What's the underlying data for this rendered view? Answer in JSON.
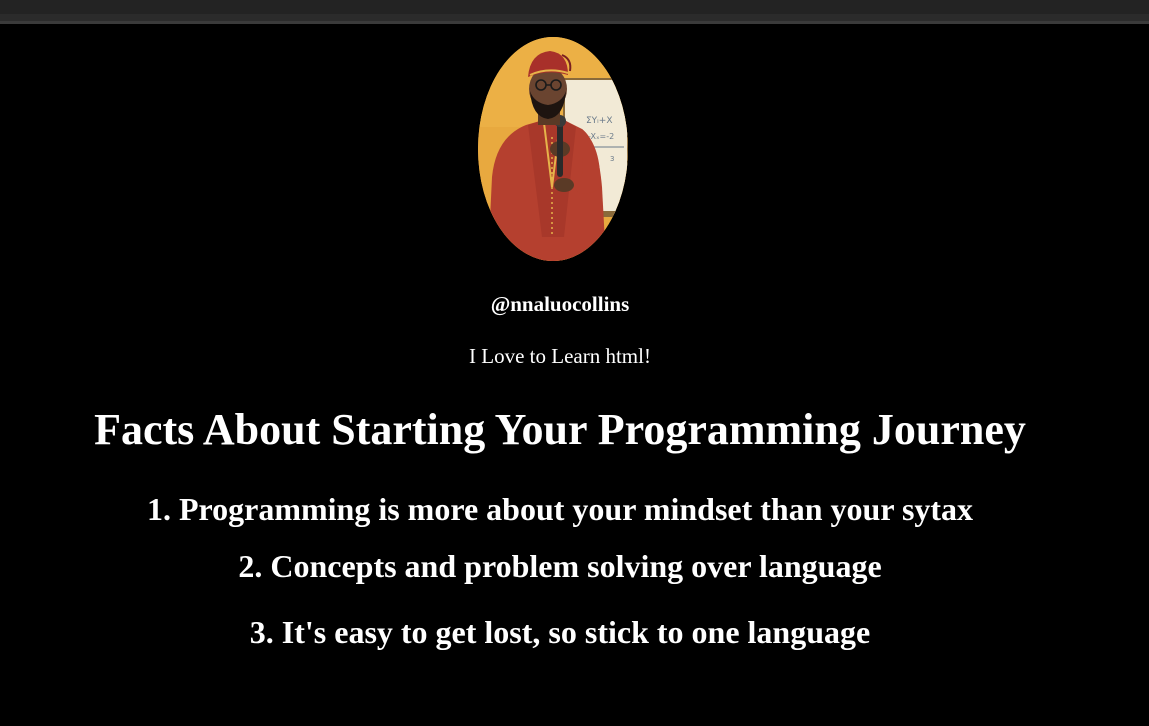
{
  "profile": {
    "handle": "@nnaluocollins",
    "tagline": "I Love to Learn html!"
  },
  "headline": "Facts About Starting Your Programming Journey",
  "facts": [
    "1. Programming is more about your mindset than your sytax",
    "2. Concepts and problem solving over language",
    "3. It's easy to get lost, so stick to one language"
  ],
  "colors": {
    "background": "#000000",
    "text": "#ffffff",
    "avatar_bg": "#e8a93f",
    "browser_bar": "#2b2b2b"
  }
}
